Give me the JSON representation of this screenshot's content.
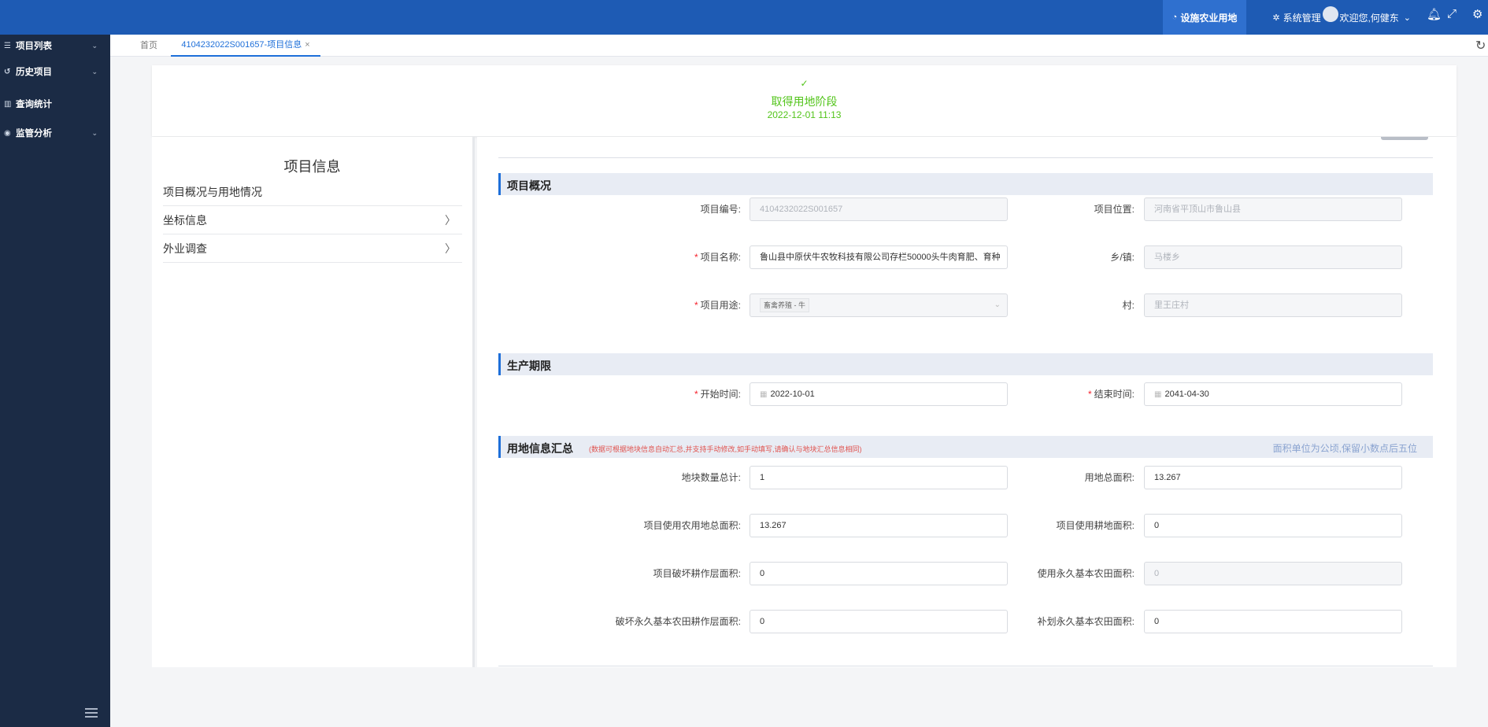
{
  "topbar": {
    "active_nav": "设施农业用地",
    "sys_nav": "系统管理",
    "welcome": "欢迎您,何健东",
    "icons": [
      "bell-icon",
      "fullscreen-icon",
      "settings-icon"
    ]
  },
  "sidebar": {
    "items": [
      {
        "label": "项目列表",
        "icon": "list-icon"
      },
      {
        "label": "历史项目",
        "icon": "history-icon"
      },
      {
        "label": "查询统计",
        "icon": "bar-chart-icon"
      },
      {
        "label": "监管分析",
        "icon": "monitor-icon"
      }
    ]
  },
  "tabs": {
    "home": "首页",
    "active": "4104232022S001657-项目信息"
  },
  "stage": {
    "title": "取得用地阶段",
    "date": "2022-12-01 11:13"
  },
  "left": {
    "title": "项目信息",
    "menu": [
      "项目概况与用地情况",
      "坐标信息",
      "外业调查"
    ]
  },
  "overview": {
    "title": "项目概况",
    "code_label": "项目编号:",
    "code_value": "4104232022S001657",
    "location_label": "项目位置:",
    "location_value": "河南省平顶山市鲁山县",
    "name_label": "项目名称:",
    "name_value": "鲁山县中原伏牛农牧科技有限公司存栏50000头牛肉育肥、育种",
    "town_label": "乡/镇:",
    "town_value": "马楼乡",
    "use_label": "项目用途:",
    "use_value": "畜禽养殖 - 牛",
    "village_label": "村:",
    "village_value": "里王庄村"
  },
  "period": {
    "title": "生产期限",
    "start_label": "开始时间:",
    "start_value": "2022-10-01",
    "end_label": "结束时间:",
    "end_value": "2041-04-30"
  },
  "landinfo": {
    "title": "用地信息汇总",
    "note": "(数据可根据地块信息自动汇总,并支持手动修改,如手动填写,请确认与地块汇总信息相同)",
    "unit": "面积单位为公顷,保留小数点后五位",
    "rows": [
      {
        "label": "地块数量总计:",
        "value": "1"
      },
      {
        "label": "用地总面积:",
        "value": "13.267"
      },
      {
        "label": "项目使用农用地总面积:",
        "value": "13.267"
      },
      {
        "label": "项目使用耕地面积:",
        "value": "0"
      },
      {
        "label": "项目破坏耕作层面积:",
        "value": "0"
      },
      {
        "label": "使用永久基本农田面积:",
        "value": "0"
      },
      {
        "label": "破坏永久基本农田耕作层面积:",
        "value": "0"
      },
      {
        "label": "补划永久基本农田面积:",
        "value": "0"
      }
    ]
  },
  "colors": {
    "topbar": "#1e5bb4",
    "sidebar": "#1b2b45",
    "accent": "#1e6fd9",
    "success": "#52c41a"
  }
}
